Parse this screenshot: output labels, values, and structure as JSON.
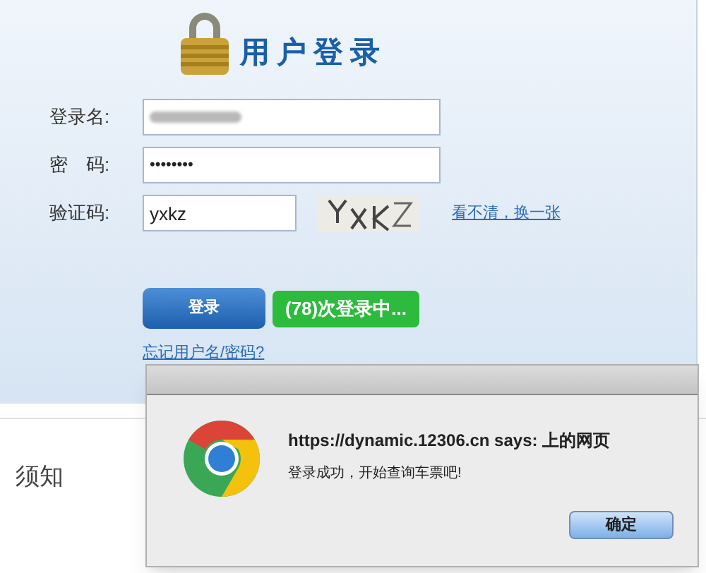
{
  "login": {
    "title": "用户登录",
    "fields": [
      {
        "label": "登录名:",
        "kind": "blurred"
      },
      {
        "label": "密　码:",
        "value": "••••••••",
        "kind": "text"
      },
      {
        "label": "验证码:",
        "value": "yxkz",
        "kind": "captcha",
        "refresh_link": "看不清，换一张"
      }
    ],
    "submit": "登录",
    "status_badge": "(78)次登录中...",
    "forgot_link": "忘记用户名/密码?"
  },
  "notice_heading": "须知",
  "dialog": {
    "title": "https://dynamic.12306.cn says: 上的网页",
    "message": "登录成功，开始查询车票吧!",
    "ok": "确定"
  }
}
